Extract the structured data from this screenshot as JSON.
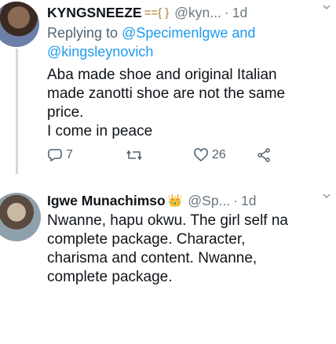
{
  "tweets": [
    {
      "name": "KYNGSNEEZE",
      "name_emoji": "=={ }",
      "handle": "@kyn...",
      "dot": "·",
      "time": "1d",
      "replying_prefix": "Replying to",
      "replying_mentions": "@Specimenlgwe and @kingsleynovich",
      "body_lines": [
        "Aba made shoe and original Italian",
        "made zanotti shoe are not the same",
        "price.",
        "I come in peace"
      ],
      "actions": {
        "reply_count": "7",
        "retweet_count": "",
        "like_count": "26"
      }
    },
    {
      "name": "Igwe Munachimso",
      "name_emoji": "👑",
      "handle": "@Sp...",
      "dot": "·",
      "time": "1d",
      "body_lines": [
        "Nwanne, hapu okwu. The girl self na",
        "complete package. Character,",
        "charisma and content. Nwanne,",
        "complete package."
      ]
    }
  ],
  "icons": {
    "more": "chevron-down-icon",
    "reply": "reply-icon",
    "retweet": "retweet-icon",
    "like": "heart-icon",
    "share": "share-icon"
  },
  "colors": {
    "link": "#1d9bf0",
    "muted": "#536471",
    "text": "#0f1419"
  }
}
